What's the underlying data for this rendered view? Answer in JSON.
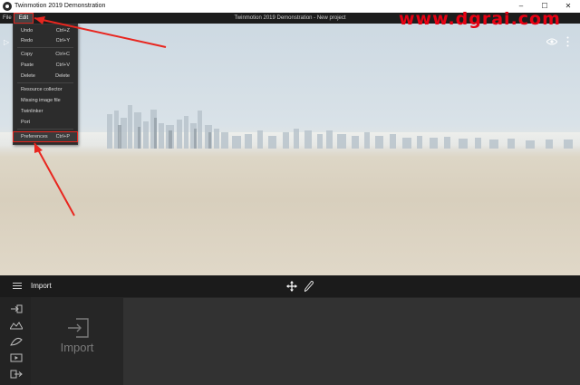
{
  "window": {
    "app_title": "Twinmotion 2019 Demonstration",
    "icon": "twinmotion-logo-icon",
    "controls": [
      "–",
      "☐",
      "✕"
    ]
  },
  "menubar": {
    "file_label": "File",
    "edit_label": "Edit",
    "project_title": "Twinmotion 2019 Demonstration - New project"
  },
  "watermark": "www.dgrai.com",
  "edit_menu": {
    "items": [
      {
        "label": "Undo",
        "shortcut": "Ctrl+Z"
      },
      {
        "label": "Redo",
        "shortcut": "Ctrl+Y"
      },
      {
        "label": "Copy",
        "shortcut": "Ctrl+C"
      },
      {
        "label": "Paste",
        "shortcut": "Ctrl+V"
      },
      {
        "label": "Delete",
        "shortcut": "Delete"
      },
      {
        "label": "Resource collector",
        "shortcut": ""
      },
      {
        "label": "Missing image file",
        "shortcut": ""
      },
      {
        "label": "Twinlinker",
        "shortcut": ""
      },
      {
        "label": "Port",
        "shortcut": ""
      },
      {
        "label": "Preferences",
        "shortcut": "Ctrl+P"
      }
    ]
  },
  "bottom_bar": {
    "title": "Import",
    "icons": [
      "hamburger-icon",
      "move-icon",
      "pen-icon"
    ]
  },
  "import_panel": {
    "label": "Import",
    "tools": [
      "import-icon",
      "terrain-icon",
      "vegetation-icon",
      "media-icon",
      "export-icon"
    ]
  },
  "colors": {
    "highlight": "#e8261f",
    "watermark": "#e60012",
    "panel_bg": "#262626"
  }
}
